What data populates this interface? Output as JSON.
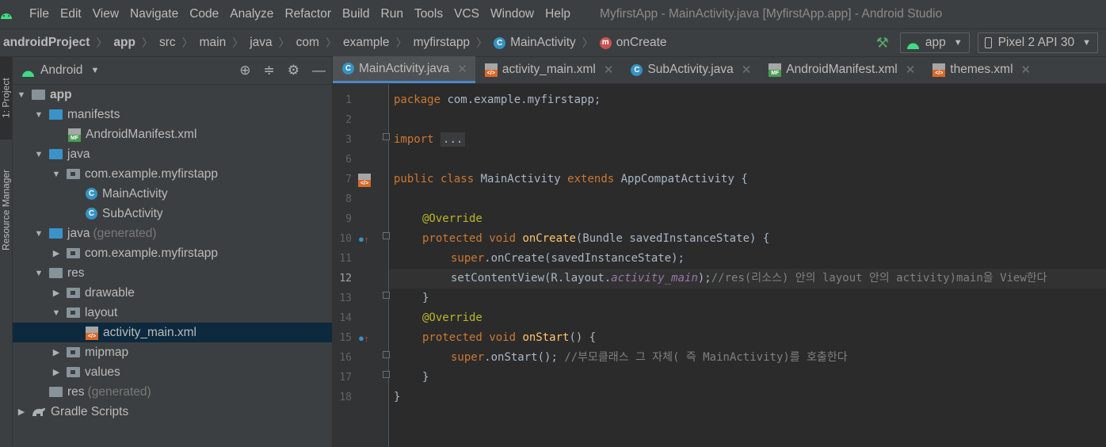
{
  "window_title": "MyfirstApp - MainActivity.java [MyfirstApp.app] - Android Studio",
  "menu": [
    "File",
    "Edit",
    "View",
    "Navigate",
    "Code",
    "Analyze",
    "Refactor",
    "Build",
    "Run",
    "Tools",
    "VCS",
    "Window",
    "Help"
  ],
  "breadcrumbs": [
    "androidProject",
    "app",
    "src",
    "main",
    "java",
    "com",
    "example",
    "myfirstapp",
    "MainActivity",
    "onCreate"
  ],
  "toolbar": {
    "run_config": "app",
    "device": "Pixel 2 API 30"
  },
  "side_tabs": {
    "project": "1: Project",
    "resource_manager": "Resource Manager"
  },
  "project_panel": {
    "view_mode": "Android",
    "tree": [
      {
        "label": "app",
        "extra": ""
      },
      {
        "label": "manifests",
        "extra": ""
      },
      {
        "label": "AndroidManifest.xml",
        "extra": ""
      },
      {
        "label": "java",
        "extra": ""
      },
      {
        "label": "com.example.myfirstapp",
        "extra": ""
      },
      {
        "label": "MainActivity",
        "extra": ""
      },
      {
        "label": "SubActivity",
        "extra": ""
      },
      {
        "label": "java",
        "extra": "(generated)"
      },
      {
        "label": "com.example.myfirstapp",
        "extra": ""
      },
      {
        "label": "res",
        "extra": ""
      },
      {
        "label": "drawable",
        "extra": ""
      },
      {
        "label": "layout",
        "extra": ""
      },
      {
        "label": "activity_main.xml",
        "extra": ""
      },
      {
        "label": "mipmap",
        "extra": ""
      },
      {
        "label": "values",
        "extra": ""
      },
      {
        "label": "res",
        "extra": "(generated)"
      },
      {
        "label": "Gradle Scripts",
        "extra": ""
      }
    ]
  },
  "editor_tabs": [
    "MainActivity.java",
    "activity_main.xml",
    "SubActivity.java",
    "AndroidManifest.xml",
    "themes.xml"
  ],
  "line_numbers": [
    "1",
    "2",
    "3",
    "6",
    "7",
    "8",
    "9",
    "10",
    "11",
    "12",
    "13",
    "14",
    "15",
    "16",
    "17",
    "18"
  ],
  "code": {
    "l1_kw": "package",
    "l1_rest": " com.example.myfirstapp;",
    "l3_kw": "import",
    "l3_fold": "...",
    "l7_kw1": "public class",
    "l7_name": " MainActivity ",
    "l7_kw2": "extends",
    "l7_rest": " AppCompatActivity {",
    "l9_ann": "@Override",
    "l10_kw": "protected void",
    "l10_fn": "onCreate",
    "l10_rest": "(Bundle savedInstanceState) {",
    "l11_kw": "super",
    "l11_rest": ".onCreate(savedInstanceState);",
    "l12_a": "setContentView(R.layout.",
    "l12_fld": "activity_main",
    "l12_b": ");",
    "l12_cmt": "//res(리소스) 안의 layout 안의 activity)main을 View한다",
    "l13": "}",
    "l14_ann": "@Override",
    "l15_kw": "protected void",
    "l15_fn": "onStart",
    "l15_rest": "() {",
    "l16_kw": "super",
    "l16_rest": ".onStart(); ",
    "l16_cmt": "//부모클래스 그 자체( 즉 MainActivity)를 호출한다",
    "l17": "}",
    "l18": "}"
  },
  "colors": {
    "keyword": "#cc7832",
    "annotation": "#bbb529",
    "function": "#ffc66d",
    "field": "#9876aa",
    "comment": "#808080",
    "selection": "#0d293e"
  }
}
